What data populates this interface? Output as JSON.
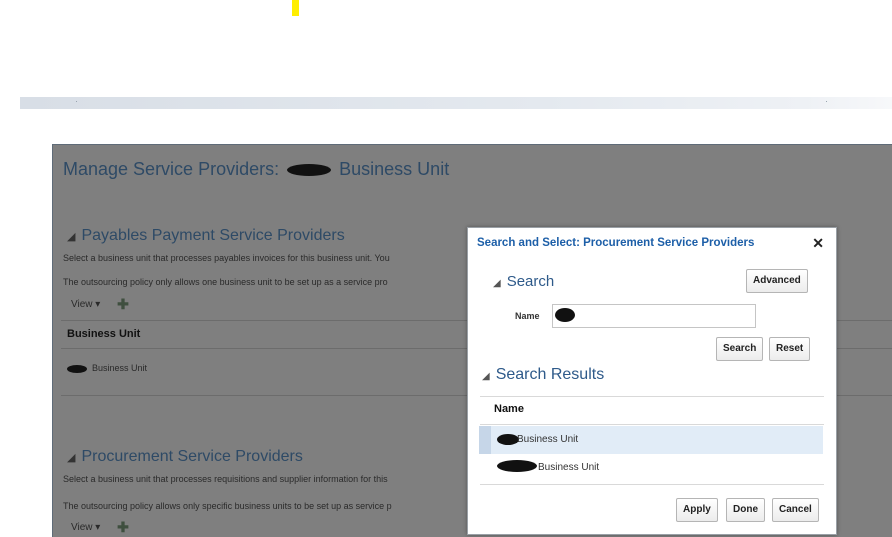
{
  "page": {
    "title": "Manage Service Providers:",
    "title_suffix": "Business Unit",
    "payables": {
      "heading": "Payables Payment Service Providers",
      "desc": "Select a business unit that processes payables invoices for this business unit. You",
      "policy": "The outsourcing policy only allows one business unit to be set up as a service pro",
      "view_label": "View",
      "column_header": "Business Unit",
      "row_value": "Business Unit"
    },
    "procurement": {
      "heading": "Procurement Service Providers",
      "desc": "Select a business unit that processes requisitions and supplier information for this",
      "policy": "The outsourcing policy allows only specific business units to be set up as service p",
      "view_label": "View"
    }
  },
  "dialog": {
    "title": "Search and Select: Procurement Service Providers",
    "close_glyph": "✕",
    "search_heading": "Search",
    "advanced_label": "Advanced",
    "name_label": "Name",
    "search_button": "Search",
    "reset_button": "Reset",
    "results_heading": "Search Results",
    "results_column": "Name",
    "results": [
      "Business Unit",
      "Business Unit"
    ],
    "apply_button": "Apply",
    "done_button": "Done",
    "cancel_button": "Cancel"
  },
  "icons": {
    "section_toggle": "collapse-triangle-icon",
    "view_arrow": "chevron-down-icon",
    "add": "plus-icon",
    "close": "close-icon"
  },
  "colors": {
    "heading_blue": "#2e4a66",
    "dialog_title_blue": "#1d5fa8",
    "selected_row": "#e1ecf7",
    "highlight_mark": "#ffee00"
  }
}
